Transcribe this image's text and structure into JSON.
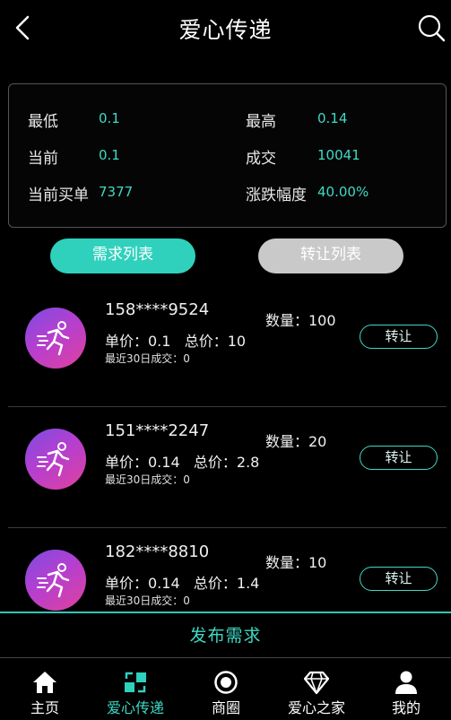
{
  "header": {
    "title": "爱心传递",
    "back_icon": "chevron-left-icon",
    "search_icon": "search-icon"
  },
  "stats": {
    "low_label": "最低",
    "low_value": "0.1",
    "high_label": "最高",
    "high_value": "0.14",
    "current_label": "当前",
    "current_value": "0.1",
    "deals_label": "成交",
    "deals_value": "10041",
    "buy_orders_label": "当前买单",
    "buy_orders_value": "7377",
    "change_label": "涨跌幅度",
    "change_value": "40.00%"
  },
  "tabs": [
    {
      "label": "需求列表",
      "active": true
    },
    {
      "label": "转让列表",
      "active": false
    }
  ],
  "orders": [
    {
      "phone": "158****9524",
      "price_text": "单价：0.1",
      "total_text": "总价：10",
      "qty_text": "数量：100",
      "recent_text": "最近30日成交：0",
      "button": "转让"
    },
    {
      "phone": "151****2247",
      "price_text": "单价：0.14",
      "total_text": "总价：2.8",
      "qty_text": "数量：20",
      "recent_text": "最近30日成交：0",
      "button": "转让"
    },
    {
      "phone": "182****8810",
      "price_text": "单价：0.14",
      "total_text": "总价：1.4",
      "qty_text": "数量：10",
      "recent_text": "最近30日成交：0",
      "button": "转让"
    }
  ],
  "publish_label": "发布需求",
  "nav": [
    {
      "label": "主页",
      "icon": "home-icon",
      "active": false
    },
    {
      "label": "爱心传递",
      "icon": "exchange-icon",
      "active": true
    },
    {
      "label": "商圈",
      "icon": "circle-target-icon",
      "active": false
    },
    {
      "label": "爱心之家",
      "icon": "diamond-icon",
      "active": false
    },
    {
      "label": "我的",
      "icon": "user-icon",
      "active": false
    }
  ],
  "colors": {
    "accent": "#2fd1bd",
    "accent_text": "#3fd9c4",
    "inactive_tab": "#c9c9c9",
    "background": "#000000"
  }
}
